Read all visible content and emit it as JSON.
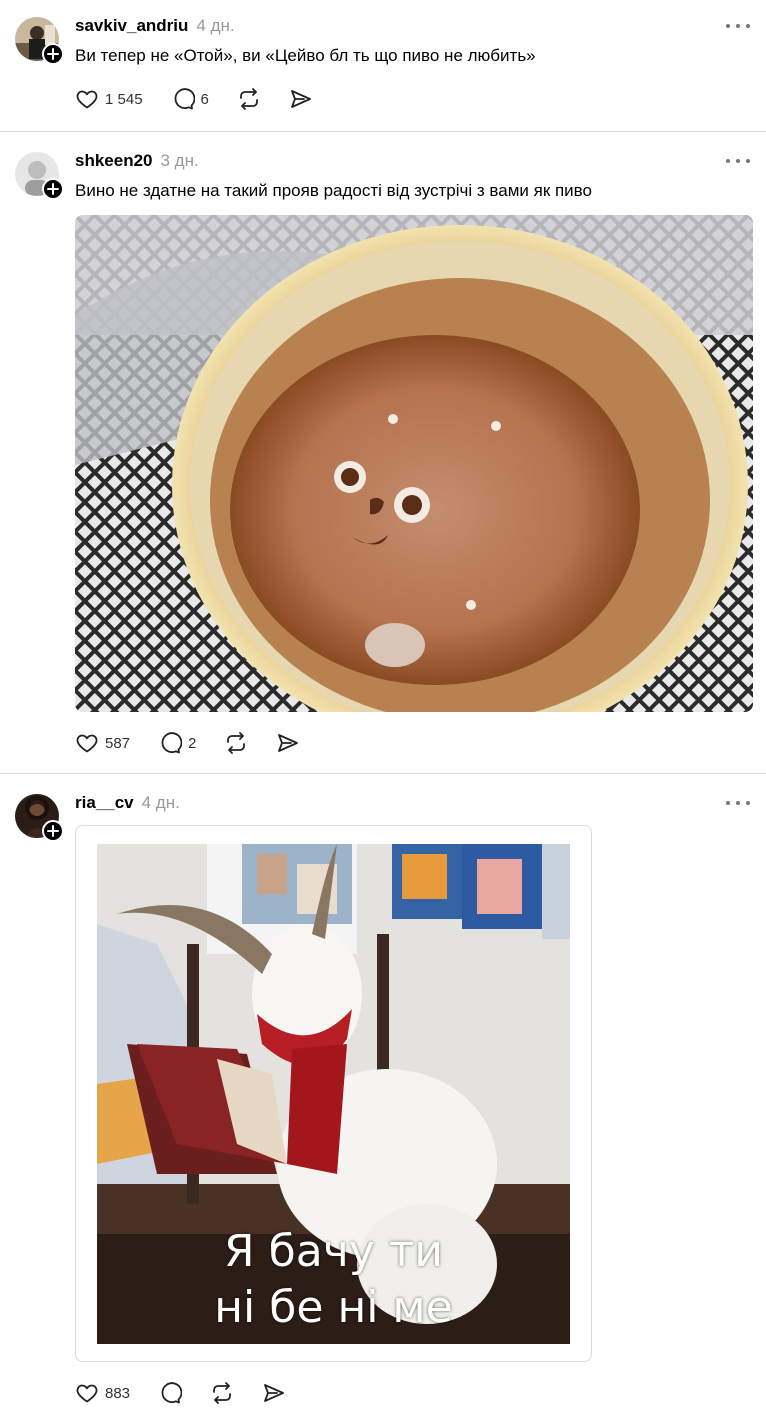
{
  "posts": [
    {
      "username": "savkiv_andriu",
      "time": "4 дн.",
      "text": "Ви тепер не «Отой», ви «Цейво бл  ть що пиво не любить»",
      "likes": "1 545",
      "comments": "6"
    },
    {
      "username": "shkeen20",
      "time": "3 дн.",
      "text": "Вино не здатне на такий прояв радості від зустрічі з вами як пиво",
      "likes": "587",
      "comments": "2",
      "image": "beer-glass-with-foam-face"
    },
    {
      "username": "ria__cv",
      "time": "4 дн.",
      "likes": "883",
      "comments": "",
      "image": "goat-with-red-scarf-in-chair",
      "meme_line1": "Я бачу ти",
      "meme_line2": "ні бе ні ме"
    }
  ],
  "icons": [
    "heart-icon",
    "comment-icon",
    "repost-icon",
    "share-icon",
    "more-icon",
    "follow-plus-icon"
  ]
}
